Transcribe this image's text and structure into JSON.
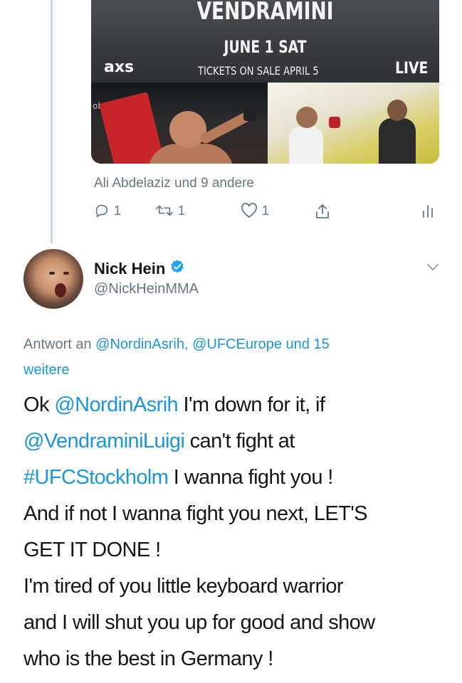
{
  "media_card": {
    "banner_name": "VENDRAMINI",
    "banner_date": "JUNE 1 SAT",
    "banner_logo": "axs",
    "banner_tickets": "TICKETS ON SALE APRIL 5",
    "banner_live": "LIVE",
    "sponsor_text": "obet"
  },
  "previous_tweet": {
    "liked_by": "Ali Abdelaziz und 9 andere",
    "reply_count": "1",
    "retweet_count": "1",
    "like_count": "1"
  },
  "tweet": {
    "display_name": "Nick Hein",
    "handle": "@NickHeinMMA",
    "reply_to_prefix": "Antwort an",
    "reply_to_mention_1": "@NordinAsrih,",
    "reply_to_mention_2": "@UFCEurope",
    "reply_to_suffix_1": "und 15",
    "reply_to_suffix_2": "weitere",
    "text": {
      "l1_a": "Ok ",
      "l1_mention": "@NordinAsrih",
      "l1_b": " I'm down for it, if",
      "l2_mention": "@VendraminiLuigi",
      "l2_b": " can't fight at",
      "l3_hashtag": "#UFCStockholm",
      "l3_b": " I wanna fight you !",
      "l4": "And if not I wanna fight you next, LET'S",
      "l5": "GET IT DONE !",
      "l6": "I'm tired of you little keyboard warrior",
      "l7": "and I will shut you up for good and show",
      "l8": "who is the best in Germany !"
    }
  },
  "colors": {
    "link": "#1b95e0",
    "secondary_text": "#657786",
    "verified": "#1da1f2",
    "thread_line": "#ccd6dd"
  },
  "icons": [
    "reply-icon",
    "retweet-icon",
    "like-icon",
    "share-icon",
    "analytics-icon",
    "verified-badge-icon",
    "chevron-down-icon"
  ]
}
